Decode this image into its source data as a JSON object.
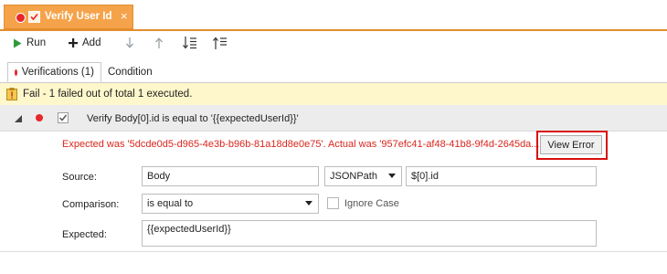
{
  "document_tab": {
    "title": "Verify User Id",
    "close": "×"
  },
  "toolbar": {
    "run": "Run",
    "add": "Add"
  },
  "subtabs": {
    "verifications": "Verifications (1)",
    "condition": "Condition"
  },
  "status": {
    "text": "Fail - 1 failed out of total 1 executed."
  },
  "verification": {
    "title": "Verify Body[0].id is equal to '{{expectedUserId}}'",
    "error": "Expected was '5dcde0d5-d965-4e3b-b96b-81a18d8e0e75'. Actual was '957efc41-af48-41b8-9f4d-2645da...",
    "view_error": "View Error"
  },
  "form": {
    "source_label": "Source:",
    "source_value": "Body",
    "source_type": "JSONPath",
    "source_path": "$[0].id",
    "comparison_label": "Comparison:",
    "comparison_value": "is equal to",
    "ignore_case": "Ignore Case",
    "expected_label": "Expected:",
    "expected_value": "{{expectedUserId}}"
  },
  "colors": {
    "tab_orange": "#f5a34a",
    "error_red": "#d9261c",
    "fail_dot": "#e8262c",
    "highlight": "#d90d0d"
  }
}
